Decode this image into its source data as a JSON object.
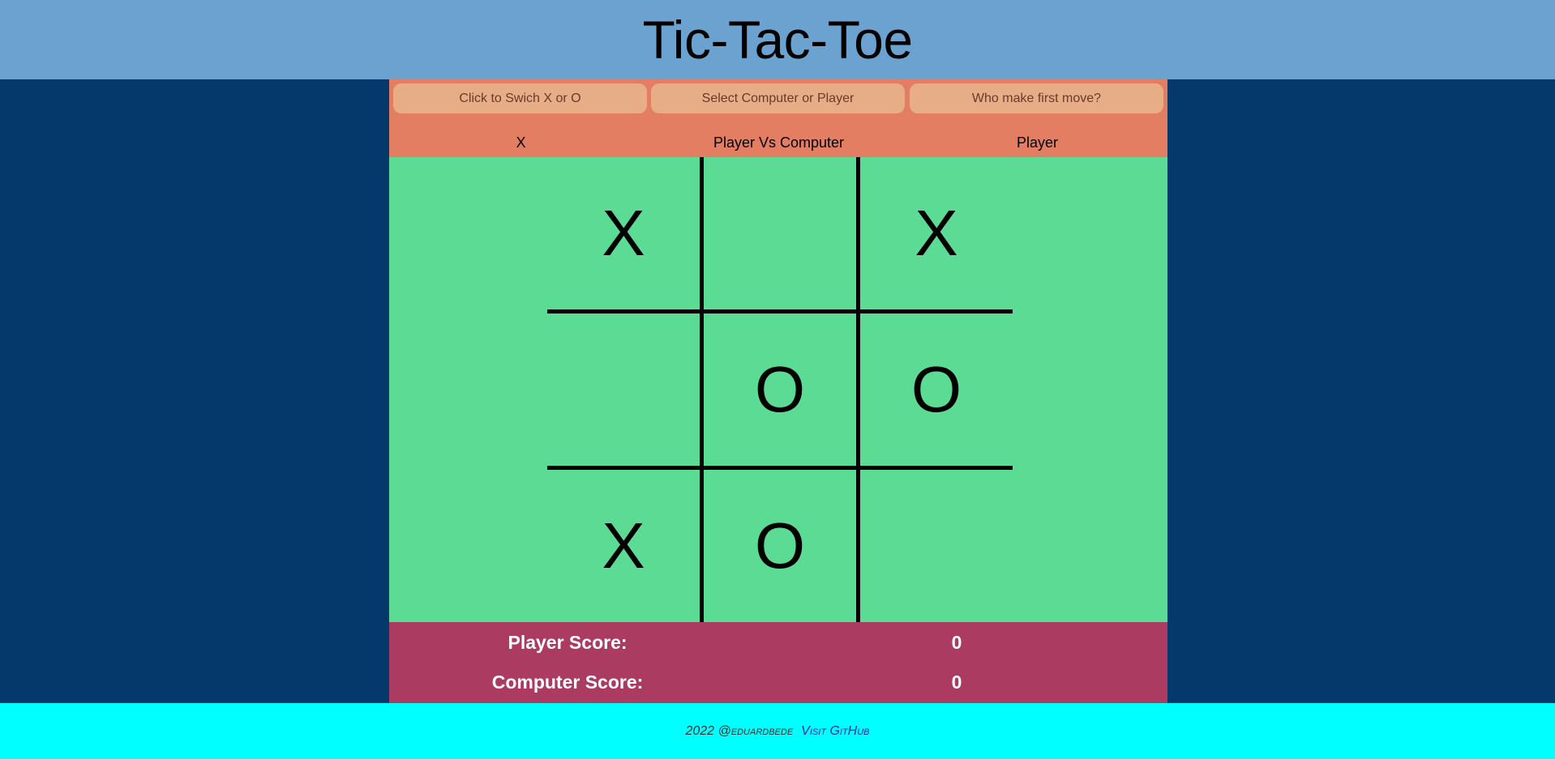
{
  "header": {
    "title": "Tic-Tac-Toe"
  },
  "controls": {
    "switch_symbol_button": "Click to Swich X or O",
    "select_opponent_button": "Select Computer or Player",
    "first_move_button": "Who make first move?",
    "symbol_value": "X",
    "mode_value": "Player Vs Computer",
    "first_move_value": "Player"
  },
  "board": {
    "cells": [
      "X",
      "",
      "X",
      "",
      "O",
      "O",
      "X",
      "O",
      ""
    ]
  },
  "scores": {
    "player_label": "Player Score:",
    "player_value": "0",
    "computer_label": "Computer Score:",
    "computer_value": "0"
  },
  "footer": {
    "credit": "2022 @eduardbede",
    "link": "Visit GitHub"
  },
  "colors": {
    "header_bg": "#6ca2d0",
    "page_bg": "#05386b",
    "controls_bg": "#e37e63",
    "button_bg": "#e7ad87",
    "board_bg": "#5cdb95",
    "scores_bg": "#ab3b61",
    "footer_bg": "#00ffff"
  }
}
